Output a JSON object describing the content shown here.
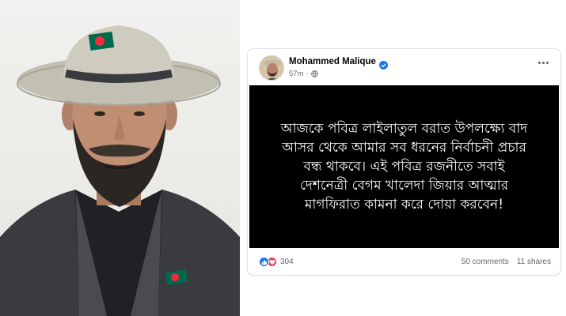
{
  "post": {
    "author": "Mohammed Malique",
    "time": "57m",
    "separator": "·",
    "body_lines": [
      "আজকে পবিত্র লাইলাতুল বরাত উপলক্ষ্যে বাদ",
      "আসর থেকে আমার সব ধরনের নির্বাচনী প্রচার",
      "বন্ধ থাকবে। এই পবিত্র রজনীতে সবাই",
      "দেশনেত্রী বেগম খালেদা জিয়ার আত্মার",
      "মাগফিরাত কামনা করে দোয়া করবেন!"
    ],
    "reaction_count": "304",
    "comments": "50 comments",
    "shares": "11 shares"
  },
  "colors": {
    "verified": "#1877f2",
    "like": "#1877f2",
    "love": "#f33e58",
    "post_background": "#000000",
    "flag_green": "#006a4e",
    "flag_red": "#f42a41"
  },
  "icons": [
    "verified-icon",
    "globe-icon",
    "more-options-icon",
    "like-reaction-icon",
    "love-reaction-icon"
  ]
}
